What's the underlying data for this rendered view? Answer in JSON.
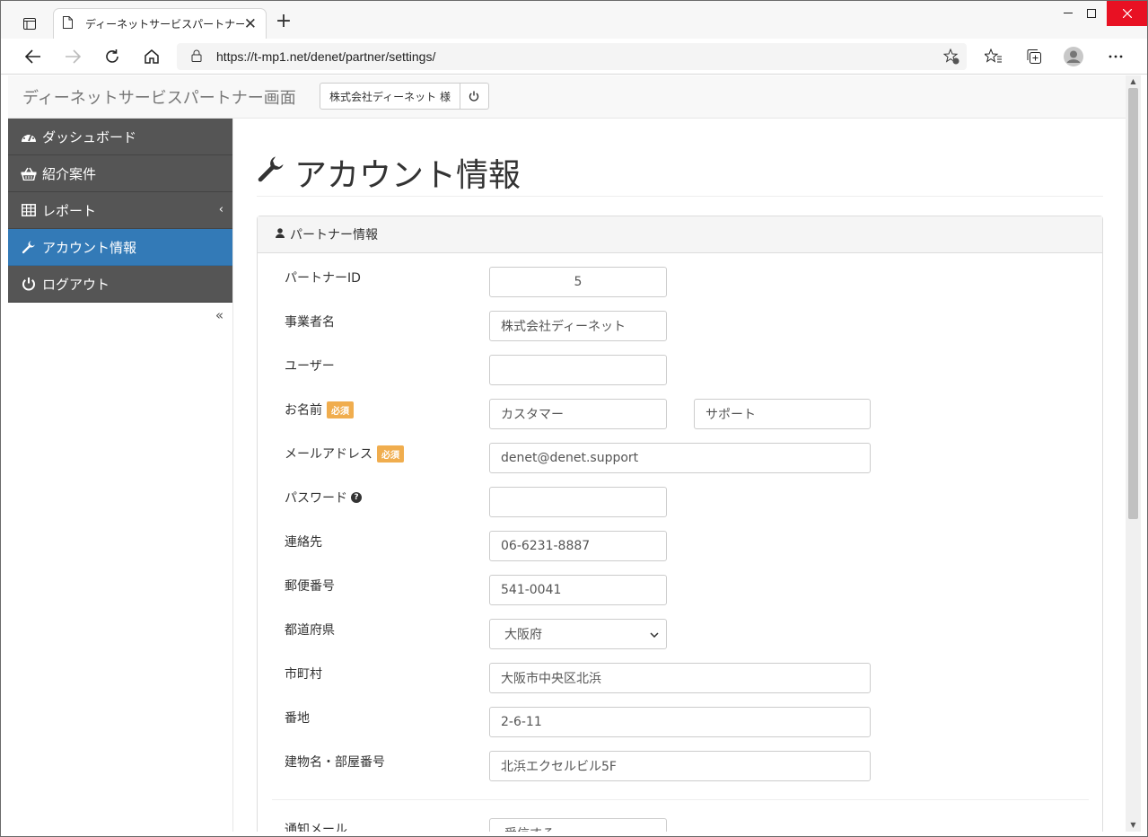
{
  "browser": {
    "tab_title": "ディーネットサービスパートナー画面",
    "url": "https://t-mp1.net/denet/partner/settings/"
  },
  "header": {
    "brand": "ディーネットサービスパートナー画面",
    "user_label": "株式会社ディーネット 様"
  },
  "sidebar": {
    "items": [
      {
        "label": "ダッシュボード",
        "icon": "dashboard-icon"
      },
      {
        "label": "紹介案件",
        "icon": "basket-icon"
      },
      {
        "label": "レポート",
        "icon": "table-icon"
      },
      {
        "label": "アカウント情報",
        "icon": "wrench-icon"
      },
      {
        "label": "ログアウト",
        "icon": "power-icon"
      }
    ],
    "collapse_label": "«"
  },
  "page": {
    "title": "アカウント情報",
    "panel_title": "パートナー情報"
  },
  "form": {
    "partner_id": {
      "label": "パートナーID",
      "value": "5"
    },
    "company": {
      "label": "事業者名",
      "value": "株式会社ディーネット"
    },
    "user": {
      "label": "ユーザー",
      "value": ""
    },
    "name": {
      "label": "お名前",
      "badge": "必須",
      "last": "カスタマー",
      "first": "サポート"
    },
    "email": {
      "label": "メールアドレス",
      "badge": "必須",
      "value": "denet@denet.support"
    },
    "password": {
      "label": "パスワード",
      "value": ""
    },
    "phone": {
      "label": "連絡先",
      "value": "06-6231-8887"
    },
    "zip": {
      "label": "郵便番号",
      "value": "541-0041"
    },
    "prefecture": {
      "label": "都道府県",
      "value": "大阪府"
    },
    "city": {
      "label": "市町村",
      "value": "大阪市中央区北浜"
    },
    "street": {
      "label": "番地",
      "value": "2-6-11"
    },
    "building": {
      "label": "建物名・部屋番号",
      "value": "北浜エクセルビル5F"
    },
    "notify": {
      "label": "通知メール",
      "value": "受信する"
    }
  },
  "colors": {
    "sidebar_bg": "#555555",
    "active_bg": "#337ab7",
    "badge": "#f0ad4e"
  }
}
